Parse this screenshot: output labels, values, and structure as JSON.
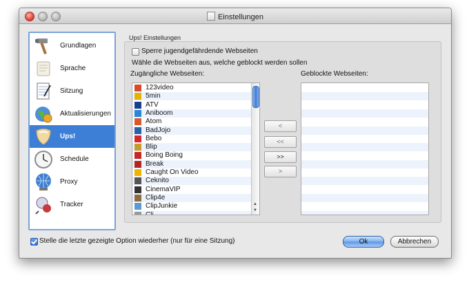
{
  "window": {
    "title": "Einstellungen"
  },
  "sidebar": {
    "items": [
      {
        "label": "Grundlagen",
        "icon": "hammer-icon"
      },
      {
        "label": "Sprache",
        "icon": "scroll-icon"
      },
      {
        "label": "Sitzung",
        "icon": "notepad-icon"
      },
      {
        "label": "Aktualisierungen",
        "icon": "globe-update-icon"
      },
      {
        "label": "Ups!",
        "icon": "shield-icon",
        "selected": true
      },
      {
        "label": "Schedule",
        "icon": "clock-icon"
      },
      {
        "label": "Proxy",
        "icon": "network-globe-icon"
      },
      {
        "label": "Tracker",
        "icon": "tracker-icon"
      }
    ]
  },
  "ups": {
    "group_title": "Ups! Einstellungen",
    "block_checkbox_label": "Sperre jugendgefährdende Webseiten",
    "instruction": "Wähle die Webseiten aus, welche geblockt werden sollen",
    "available_header": "Zugängliche Webseiten:",
    "blocked_header": "Geblockte Webseiten:",
    "available_sites": [
      {
        "name": "123video",
        "color": "#d94a2b"
      },
      {
        "name": "5min",
        "color": "#e3b100"
      },
      {
        "name": "ATV",
        "color": "#1a3f8f"
      },
      {
        "name": "Aniboom",
        "color": "#2a86d6"
      },
      {
        "name": "Atom",
        "color": "#d85a2a"
      },
      {
        "name": "BadJojo",
        "color": "#2d5fa8"
      },
      {
        "name": "Bebo",
        "color": "#d8262d"
      },
      {
        "name": "Blip",
        "color": "#c89a2a"
      },
      {
        "name": "Boing Boing",
        "color": "#c62828"
      },
      {
        "name": "Break",
        "color": "#b3261e"
      },
      {
        "name": "Caught On Video",
        "color": "#f0b400"
      },
      {
        "name": "Ceknito",
        "color": "#555555"
      },
      {
        "name": "CinemaVIP",
        "color": "#333333"
      },
      {
        "name": "Clip4e",
        "color": "#8a6d3b"
      },
      {
        "name": "ClipJunkie",
        "color": "#5a9ad6"
      }
    ],
    "partial_row": "Cli...",
    "buttons": {
      "move_left": "<",
      "move_all_left": "<<",
      "move_all_right": ">>",
      "move_right": ">"
    }
  },
  "footer": {
    "remember_option_label": "Stelle die letzte gezeigte Option wiederher (nur für eine Sitzung)",
    "ok_label": "Ok",
    "cancel_label": "Abbrechen"
  }
}
